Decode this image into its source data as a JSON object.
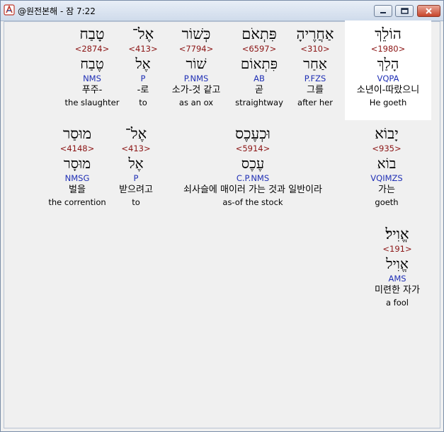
{
  "window": {
    "title": "@원전본해 - 잠 7:22"
  },
  "rows": [
    [
      {
        "heb": "הוֹלֵךְ",
        "num": "<1980>",
        "lemma": "הָלַךְ",
        "parse": "VQPA",
        "kor": "소년이-따랐으니",
        "eng": "He goeth"
      },
      {
        "heb": "אַחֲרֶיהָ",
        "num": "<310>",
        "lemma": "אַחַר",
        "parse": "P.FZS",
        "kor": "그를",
        "eng": "after her"
      },
      {
        "heb": "פִּתְאֹם",
        "num": "<6597>",
        "lemma": "פִּתְאוֹם",
        "parse": "AB",
        "kor": "곧",
        "eng": "straightway"
      },
      {
        "heb": "כְּשׁוֹר",
        "num": "<7794>",
        "lemma": "שׁוֹר",
        "parse": "P.NMS",
        "kor": "소가-것 같고",
        "eng": "as an ox"
      },
      {
        "heb": "אֶל־",
        "num": "<413>",
        "lemma": "אֶל",
        "parse": "P",
        "kor": "-로",
        "eng": "to"
      },
      {
        "heb": "טָבַח",
        "num": "<2874>",
        "lemma": "טֶבַח",
        "parse": "NMS",
        "kor": "푸주-",
        "eng": "the slaughter"
      }
    ],
    [
      {
        "heb": "יָבוֹא",
        "num": "<935>",
        "lemma": "בוֹא",
        "parse": "VQIMZS",
        "kor": "가는",
        "eng": "goeth"
      },
      {
        "heb": "וּכְעֶכֶס",
        "num": "<5914>",
        "lemma": "עֶכֶס",
        "parse": "C.P.NMS",
        "kor": "쇠사슬에 매이러 가는 것과 일반이라",
        "eng": "as-of the stock"
      },
      {
        "heb": "אֶל־",
        "num": "<413>",
        "lemma": "אֶל",
        "parse": "P",
        "kor": "받으려고",
        "eng": "to"
      },
      {
        "heb": "מוּסַר",
        "num": "<4148>",
        "lemma": "מוּסָר",
        "parse": "NMSG",
        "kor": "벌을",
        "eng": "the corrention"
      }
    ],
    [
      {
        "heb": "אֱוִיל׃",
        "num": "<191>",
        "lemma": "אֱוִיל",
        "parse": "AMS",
        "kor": "미련한 자가",
        "eng": "a fool"
      }
    ]
  ]
}
